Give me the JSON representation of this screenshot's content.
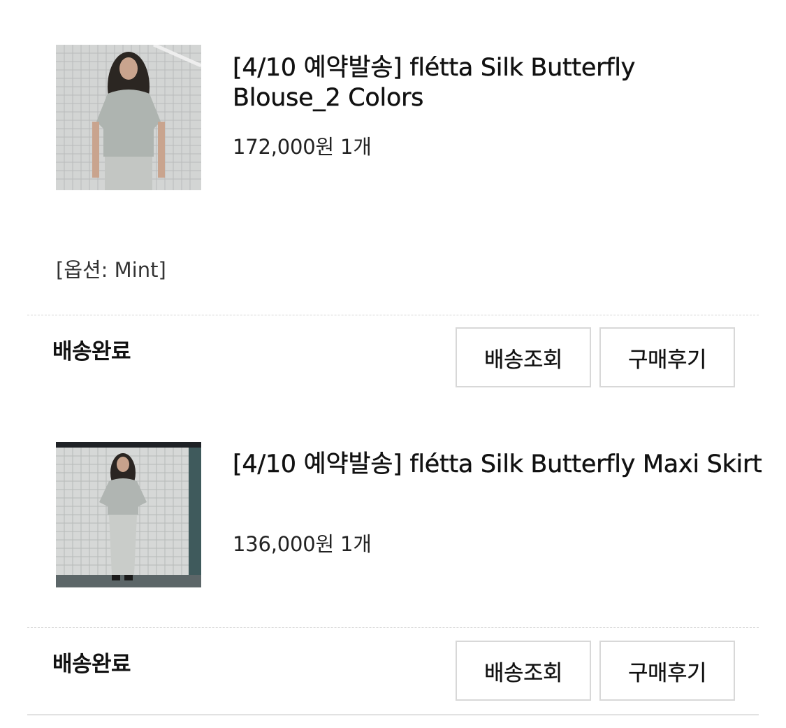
{
  "orders": [
    {
      "title": "[4/10 예약발송] flétta Silk Butterfly Blouse_2 Colors",
      "price": "172,000원",
      "quantity": "1개",
      "option": "[옵션: Mint]",
      "status": "배송완료",
      "track_button": "배송조회",
      "review_button": "구매후기"
    },
    {
      "title": "[4/10 예약발송] flétta Silk Butterfly Maxi Skirt",
      "price": "136,000원",
      "quantity": "1개",
      "status": "배송완료",
      "track_button": "배송조회",
      "review_button": "구매후기"
    }
  ]
}
